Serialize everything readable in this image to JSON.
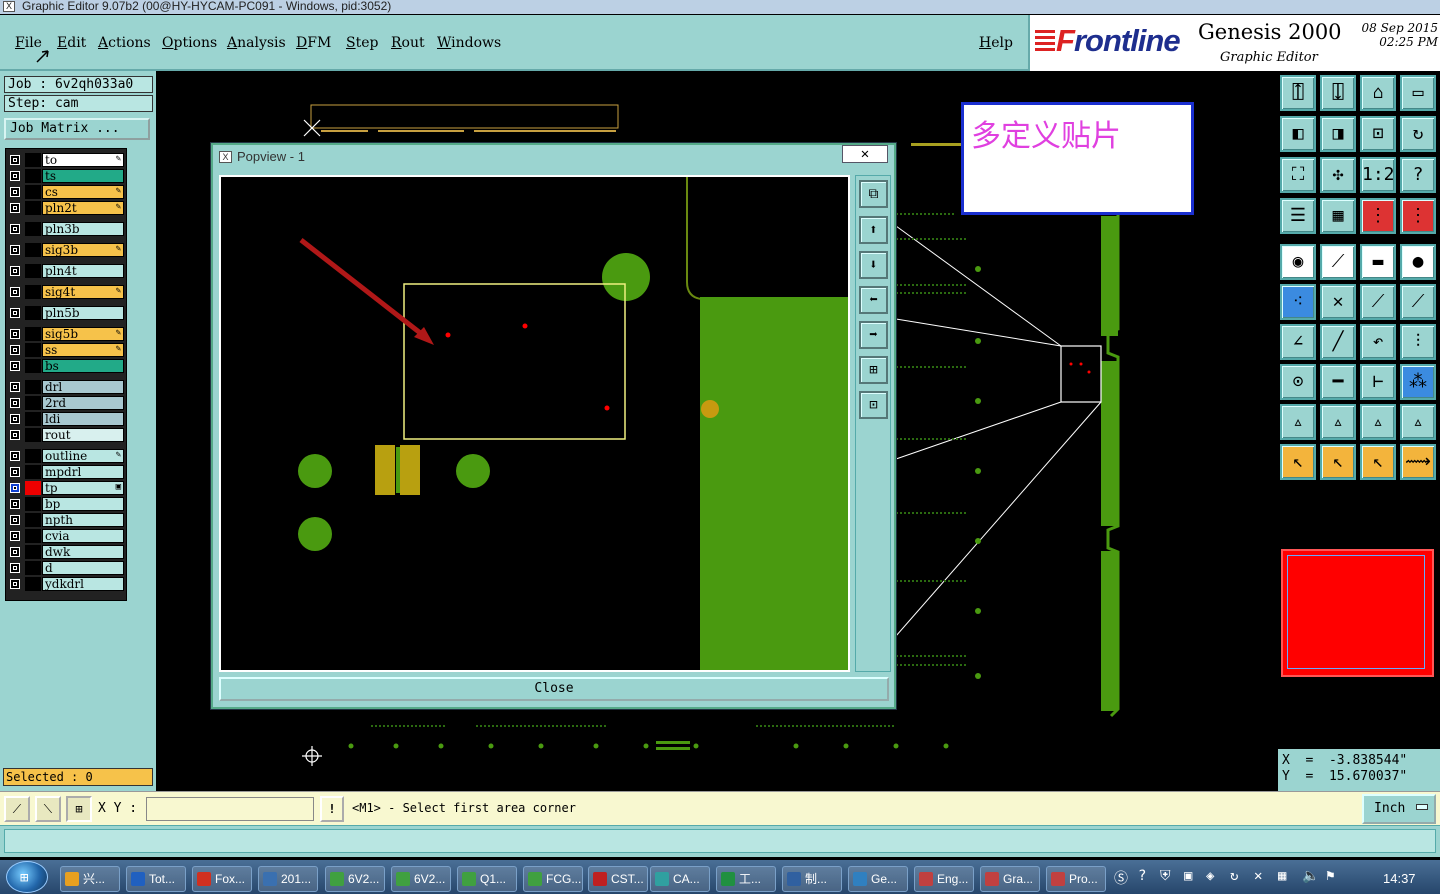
{
  "window": {
    "title": "Graphic Editor 9.07b2 (00@HY-HYCAM-PC091 - Windows, pid:3052)"
  },
  "menu": [
    "File",
    "Edit",
    "Actions",
    "Options",
    "Analysis",
    "DFM",
    "Step",
    "Rout",
    "Windows"
  ],
  "help": "Help",
  "brand": {
    "logo_prefix": "F",
    "logo_rest": "rontline",
    "product": "Genesis 2000",
    "date": "08 Sep 2015",
    "time": "02:25 PM",
    "subtitle": "Graphic Editor"
  },
  "job": {
    "job": "Job : 6v2qh033a0",
    "step": "Step: cam",
    "matrix_button": "Job Matrix ..."
  },
  "layers": [
    {
      "name": "to",
      "color": "#ffffff",
      "mark": "✎"
    },
    {
      "name": "ts",
      "color": "#22aa88",
      "mark": ""
    },
    {
      "name": "cs",
      "color": "#f6c24a",
      "mark": "✎"
    },
    {
      "name": "pln2t",
      "color": "#f6c24a",
      "mark": "✎"
    },
    {
      "name": "pln3b",
      "color": "#b9e6e2",
      "mark": ""
    },
    {
      "name": "sig3b",
      "color": "#f6c24a",
      "mark": "✎"
    },
    {
      "name": "pln4t",
      "color": "#b9e6e2",
      "mark": ""
    },
    {
      "name": "sig4t",
      "color": "#f6c24a",
      "mark": "✎"
    },
    {
      "name": "pln5b",
      "color": "#b9e6e2",
      "mark": ""
    },
    {
      "name": "sig5b",
      "color": "#f6c24a",
      "mark": "✎"
    },
    {
      "name": "ss",
      "color": "#f6c24a",
      "mark": "✎"
    },
    {
      "name": "bs",
      "color": "#22aa88",
      "mark": ""
    },
    {
      "name": "drl",
      "color": "#a8c8d0",
      "mark": ""
    },
    {
      "name": "2rd",
      "color": "#a8c8d0",
      "mark": ""
    },
    {
      "name": "ldi",
      "color": "#a8c8d0",
      "mark": ""
    },
    {
      "name": "rout",
      "color": "#d8f0ee",
      "mark": ""
    },
    {
      "name": "outline",
      "color": "#b9e6e2",
      "mark": "✎"
    },
    {
      "name": "mpdrl",
      "color": "#b9e6e2",
      "mark": ""
    },
    {
      "name": "tp",
      "color": "#b9e6e2",
      "mark": "▣"
    },
    {
      "name": "bp",
      "color": "#b9e6e2",
      "mark": ""
    },
    {
      "name": "npth",
      "color": "#b9e6e2",
      "mark": ""
    },
    {
      "name": "cvia",
      "color": "#b9e6e2",
      "mark": ""
    },
    {
      "name": "dwk",
      "color": "#b9e6e2",
      "mark": ""
    },
    {
      "name": "d",
      "color": "#b9e6e2",
      "mark": ""
    },
    {
      "name": "ydkdrl",
      "color": "#b9e6e2",
      "mark": ""
    }
  ],
  "selected": "Selected : 0",
  "popup": {
    "title": "Popview - 1",
    "close_x": "✕",
    "close_label": "Close"
  },
  "note": "多定义贴片",
  "coords": {
    "x": "X  =  -3.838544\"",
    "y": "Y  =  15.670037\""
  },
  "command": {
    "xy_label": "X Y :",
    "xy_value": "",
    "prompt": "<M1> - Select first area corner",
    "units": "Inch"
  },
  "taskbar": {
    "items": [
      "兴...",
      "Tot...",
      "Fox...",
      "201...",
      "6V2...",
      "6V2...",
      "Q1...",
      "FCG...",
      "CST...",
      "CA...",
      "工...",
      "制...",
      "Ge...",
      "Eng...",
      "Gra...",
      "Pro..."
    ],
    "clock": "14:37"
  },
  "colors": {
    "accent": "#9bd4d0",
    "layer_active": "#f6c24a",
    "board_green": "#4a9a10"
  }
}
